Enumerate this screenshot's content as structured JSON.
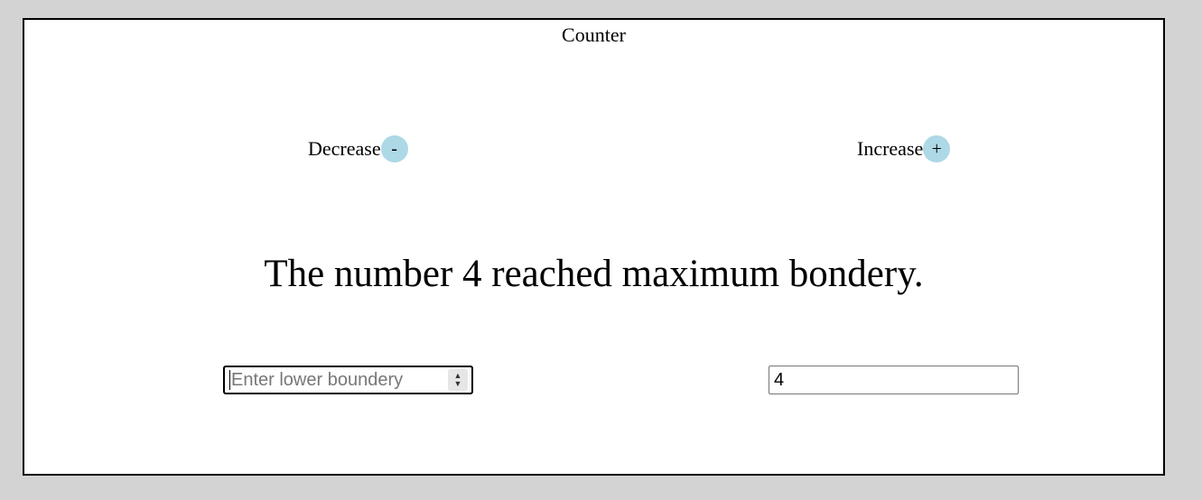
{
  "app": {
    "title": "Counter"
  },
  "controls": {
    "decrease_label": "Decrease",
    "decrease_symbol": "-",
    "increase_label": "Increase",
    "increase_symbol": "+"
  },
  "message": "The number 4 reached maximum bondery.",
  "inputs": {
    "lower": {
      "placeholder": "Enter lower boundery",
      "value": ""
    },
    "upper": {
      "value": "4"
    }
  },
  "colors": {
    "page_background": "#d3d3d3",
    "panel_background": "#ffffff",
    "button_background": "#add8e6"
  }
}
